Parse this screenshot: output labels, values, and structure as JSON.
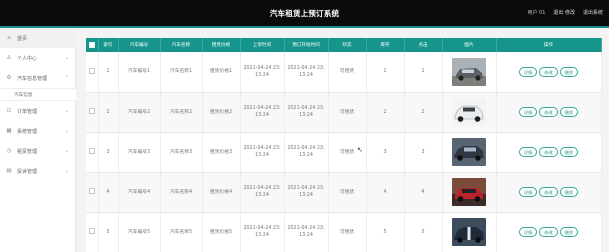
{
  "header": {
    "title": "汽车租赁上预订系统",
    "links": [
      "用户 01",
      "退出 修改",
      "退出系统"
    ]
  },
  "sidebar": {
    "items": [
      {
        "icon": "home-icon",
        "glyph": "⌂",
        "label": "首页",
        "chevron": ""
      },
      {
        "icon": "user-icon",
        "glyph": "♙",
        "label": "个人中心",
        "chevron": "⌄"
      },
      {
        "icon": "car-icon",
        "glyph": "⚙",
        "label": "汽车信息管理",
        "chevron": "⌃"
      },
      {
        "icon": "list-icon",
        "glyph": "☷",
        "label": "订单管理",
        "chevron": "⌄"
      },
      {
        "icon": "grid-icon",
        "glyph": "▦",
        "label": "系统管理",
        "chevron": "⌄"
      },
      {
        "icon": "clock-icon",
        "glyph": "◷",
        "label": "租赁管理",
        "chevron": "⌄"
      },
      {
        "icon": "document-icon",
        "glyph": "▤",
        "label": "投诉管理",
        "chevron": "⌄"
      }
    ],
    "subitem": "汽车信息"
  },
  "table": {
    "columns": [
      "索引",
      "汽车编号",
      "汽车名称",
      "租赁价格",
      "上架时间",
      "预订开始时间",
      "状态",
      "库存",
      "点击",
      "图片",
      "操作"
    ],
    "rows": [
      {
        "index": "1",
        "code": "汽车编号1",
        "name": "汽车名称1",
        "price": "租赁价格1",
        "date1": "2021-04-24 23:\n13:24",
        "date2": "2021-04-24 23:\n13:24",
        "status": "可租赁",
        "stock": "1",
        "clicks": "1"
      },
      {
        "index": "2",
        "code": "汽车编号2",
        "name": "汽车名称2",
        "price": "租赁价格2",
        "date1": "2021-04-24 23:\n13:24",
        "date2": "2021-04-24 23:\n13:24",
        "status": "可租赁",
        "stock": "2",
        "clicks": "2"
      },
      {
        "index": "3",
        "code": "汽车编号3",
        "name": "汽车名称3",
        "price": "租赁价格3",
        "date1": "2021-04-24 23:\n13:24",
        "date2": "2021-04-24 23:\n13:24",
        "status": "可租赁",
        "stock": "3",
        "clicks": "3"
      },
      {
        "index": "4",
        "code": "汽车编号4",
        "name": "汽车名称4",
        "price": "租赁价格4",
        "date1": "2021-04-24 23:\n13:24",
        "date2": "2021-04-24 23:\n13:24",
        "status": "可租赁",
        "stock": "4",
        "clicks": "4"
      },
      {
        "index": "5",
        "code": "汽车编号5",
        "name": "汽车名称5",
        "price": "租赁价格5",
        "date1": "2021-04-24 23:\n13:24",
        "date2": "2021-04-24 23:\n13:24",
        "status": "可租赁",
        "stock": "5",
        "clicks": "5"
      }
    ],
    "actions": [
      "详情",
      "修改",
      "删除"
    ]
  },
  "colors": {
    "accent": "#16958c",
    "topbar": "#0b0b0b"
  }
}
